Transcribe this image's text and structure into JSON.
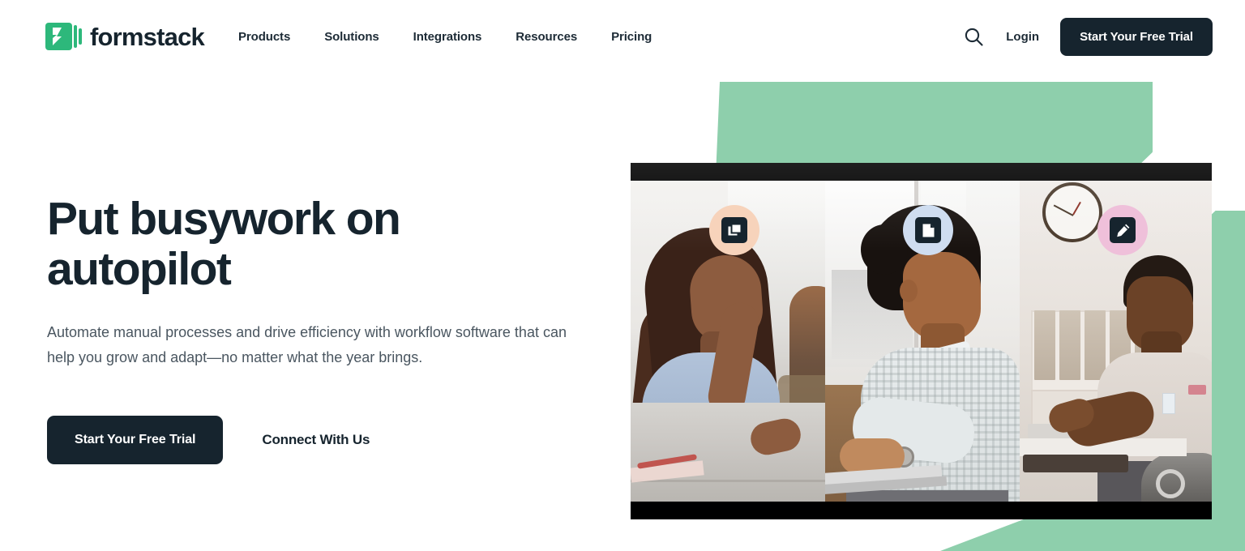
{
  "brand": {
    "name": "formstack",
    "logo_icon": "formstack-bolt-logo",
    "accent_green": "#2DB87B"
  },
  "header": {
    "nav": [
      {
        "label": "Products"
      },
      {
        "label": "Solutions"
      },
      {
        "label": "Integrations"
      },
      {
        "label": "Resources"
      },
      {
        "label": "Pricing"
      }
    ],
    "search_icon": "search-icon",
    "login_label": "Login",
    "cta_label": "Start Your Free Trial",
    "cta_color": "#16242e"
  },
  "hero": {
    "title": "Put busywork on autopilot",
    "subtitle": "Automate manual processes and drive efficiency with workflow software that can help you grow and adapt—no matter what the year brings.",
    "primary_cta": "Start Your Free Trial",
    "secondary_cta": "Connect With Us",
    "decor_green": "#8ECFAC",
    "badges": [
      {
        "icon": "documents-copy-icon",
        "circle_color": "#F7D3BB"
      },
      {
        "icon": "document-page-icon",
        "circle_color": "#CFDDF0"
      },
      {
        "icon": "pencil-sign-icon",
        "circle_color": "#EFC0DA"
      }
    ],
    "image_alt_panels": [
      "woman-at-desk-panel",
      "man-typing-on-laptop-panel",
      "man-working-in-office-panel"
    ]
  }
}
